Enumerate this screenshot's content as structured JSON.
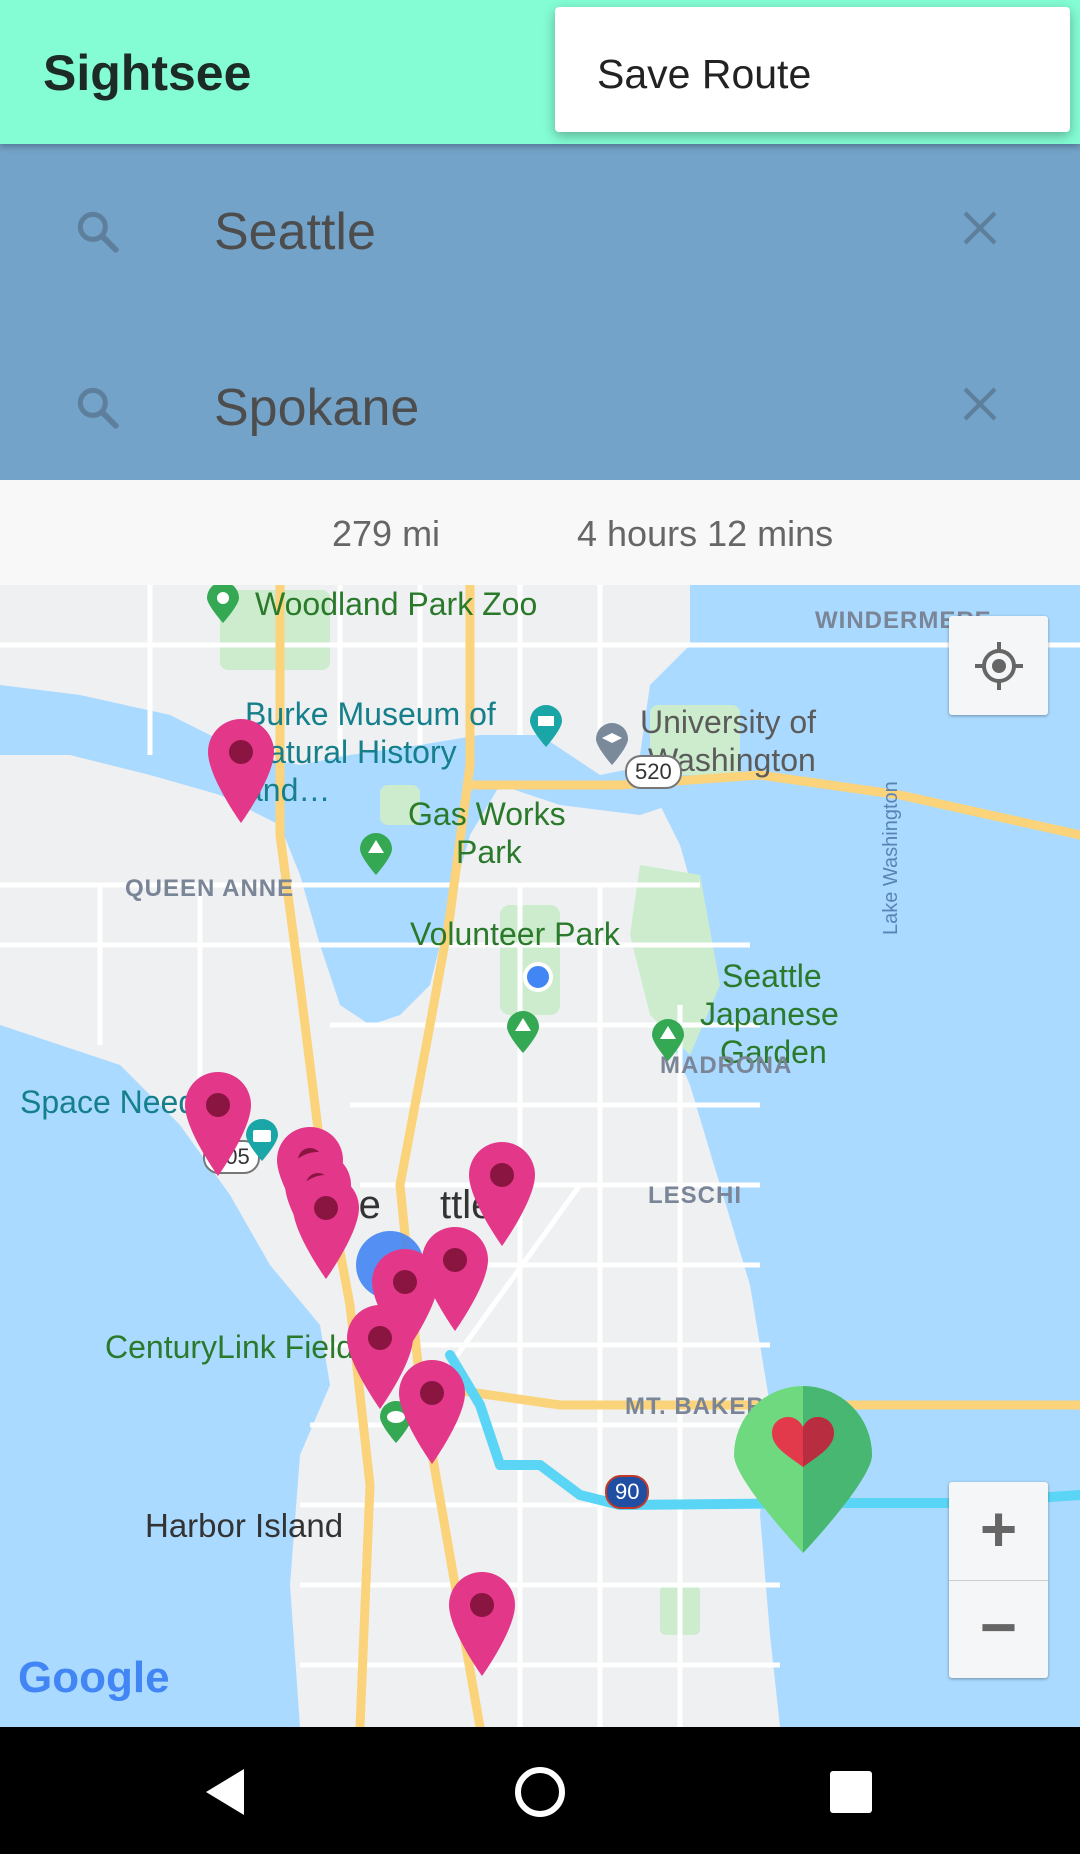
{
  "app": {
    "title": "Sightsee"
  },
  "menu": {
    "items": [
      {
        "label": "Save Route"
      }
    ]
  },
  "search": {
    "origin": {
      "value": "Seattle",
      "icon": "search-icon",
      "clear_icon": "close-icon"
    },
    "destination": {
      "value": "Spokane",
      "icon": "search-icon",
      "clear_icon": "close-icon"
    }
  },
  "route": {
    "distance": "279 mi",
    "duration": "4 hours 12 mins"
  },
  "map": {
    "pois": {
      "zoo": "Woodland Park Zoo",
      "burke": "Burke Museum of Natural History and…",
      "uw_line1": "University of",
      "uw_line2": "Washington",
      "gasworks_line1": "Gas Works",
      "gasworks_line2": "Park",
      "volunteer": "Volunteer Park",
      "japanese_line1": "Seattle",
      "japanese_line2": "Japanese",
      "japanese_line3": "Garden",
      "space_needle": "Space Needl",
      "centurylink": "CenturyLink Field",
      "harbor": "Harbor Island",
      "city": "Se",
      "city_tail": "ttle"
    },
    "areas": {
      "windermere": "WINDERMERE",
      "queen_anne": "QUEEN ANNE",
      "madrona": "MADRONA",
      "leschi": "LESCHI",
      "mt_baker": "MT. BAKER"
    },
    "water": {
      "lake_washington": "Lake Washington"
    },
    "shields": {
      "sr520": "520",
      "sr305": "305",
      "i90": "90"
    },
    "controls": {
      "zoom_in": "+",
      "zoom_out": "−"
    },
    "branding": {
      "google": "Google"
    },
    "colors": {
      "water": "#aadaff",
      "land": "#eef0f2",
      "park": "#cdeccd",
      "highway": "#fbd37a",
      "route": "#5bd5f5",
      "marker": "#e3378a",
      "marker_dot": "#8a1541",
      "heart_marker": "#6fd97f"
    }
  },
  "system_nav": {
    "back": "back-icon",
    "home": "home-icon",
    "recents": "recents-icon"
  }
}
